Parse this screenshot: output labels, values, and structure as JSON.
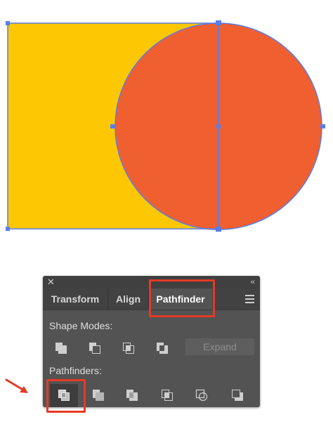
{
  "canvas": {
    "rect_color": "#FDC703",
    "circle_color": "#F05F30",
    "selection_color": "#5A7DE8"
  },
  "panel": {
    "close_glyph": "✕",
    "collapse_glyph": "‹‹",
    "tabs": [
      {
        "label": "Transform"
      },
      {
        "label": "Align"
      },
      {
        "label": "Pathfinder"
      }
    ],
    "menu_icon": "hamburger-menu-icon",
    "shape_modes_label": "Shape Modes:",
    "shape_modes": [
      "unite-icon",
      "minus-front-icon",
      "intersect-icon",
      "exclude-icon"
    ],
    "expand_label": "Expand",
    "pathfinders_label": "Pathfinders:",
    "pathfinders": [
      "divide-icon",
      "trim-icon",
      "merge-icon",
      "crop-icon",
      "outline-icon",
      "minus-back-icon"
    ]
  },
  "annotation": {
    "highlight_color": "#E53A26"
  }
}
